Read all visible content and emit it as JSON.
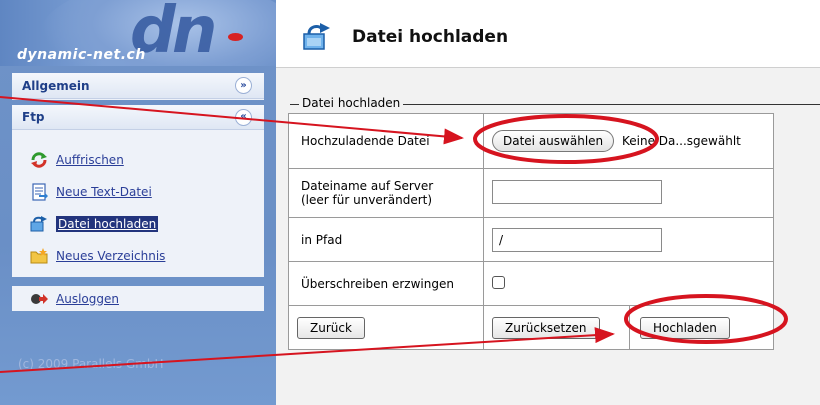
{
  "logo": {
    "mark": "dn",
    "text": "dynamic-net.ch"
  },
  "sidebar": {
    "sections": [
      {
        "title": "Allgemein",
        "toggle": "»"
      },
      {
        "title": "Ftp",
        "toggle": "«"
      }
    ],
    "items": [
      {
        "label": "Auffrischen",
        "icon": "refresh-icon"
      },
      {
        "label": "Neue Text-Datei",
        "icon": "new-text-file-icon"
      },
      {
        "label": "Datei hochladen",
        "icon": "upload-file-icon",
        "active": true
      },
      {
        "label": "Neues Verzeichnis",
        "icon": "new-folder-icon"
      }
    ],
    "logout": {
      "label": "Ausloggen",
      "icon": "logout-icon"
    },
    "copyright": "(c) 2009 Parallels GmbH"
  },
  "main": {
    "title": "Datei hochladen",
    "title_icon": "upload-file-icon",
    "legend": "Datei hochladen",
    "rows": {
      "file": {
        "label": "Hochzuladende Datei",
        "button": "Datei auswählen",
        "status": "Keine Da...sgewählt"
      },
      "name": {
        "label_line1": "Dateiname auf Server",
        "label_line2": "(leer für unverändert)",
        "value": ""
      },
      "path": {
        "label": "in Pfad",
        "value": "/"
      },
      "overwrite": {
        "label": "Überschreiben erzwingen",
        "checked": false
      }
    },
    "buttons": {
      "back": "Zurück",
      "reset": "Zurücksetzen",
      "upload": "Hochladen"
    }
  },
  "colors": {
    "annotation": "#d6141f",
    "sidebar": "#6f93c8",
    "link": "#2a3e98",
    "active_bg": "#22347d"
  }
}
